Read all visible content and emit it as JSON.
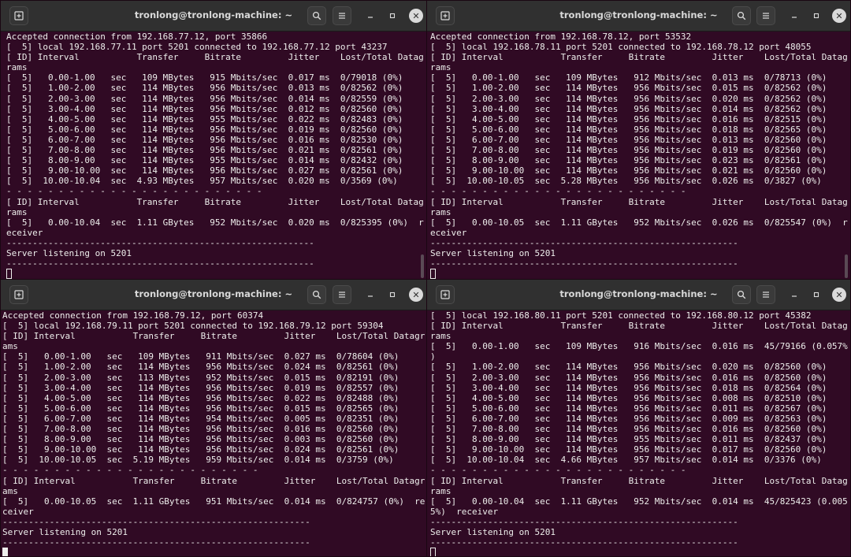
{
  "windows": [
    {
      "title": "tronlong@tronlong-machine: ~",
      "cursor_style": "hollow",
      "lines": [
        "Accepted connection from 192.168.77.12, port 35866",
        "[  5] local 192.168.77.11 port 5201 connected to 192.168.77.12 port 43237",
        "[ ID] Interval           Transfer     Bitrate         Jitter    Lost/Total Datag",
        "rams",
        "[  5]   0.00-1.00   sec   109 MBytes   915 Mbits/sec  0.017 ms  0/79018 (0%)",
        "[  5]   1.00-2.00   sec   114 MBytes   956 Mbits/sec  0.013 ms  0/82562 (0%)",
        "[  5]   2.00-3.00   sec   114 MBytes   956 Mbits/sec  0.014 ms  0/82559 (0%)",
        "[  5]   3.00-4.00   sec   114 MBytes   956 Mbits/sec  0.012 ms  0/82560 (0%)",
        "[  5]   4.00-5.00   sec   114 MBytes   955 Mbits/sec  0.022 ms  0/82483 (0%)",
        "[  5]   5.00-6.00   sec   114 MBytes   956 Mbits/sec  0.019 ms  0/82560 (0%)",
        "[  5]   6.00-7.00   sec   114 MBytes   956 Mbits/sec  0.016 ms  0/82530 (0%)",
        "[  5]   7.00-8.00   sec   114 MBytes   956 Mbits/sec  0.021 ms  0/82561 (0%)",
        "[  5]   8.00-9.00   sec   114 MBytes   955 Mbits/sec  0.014 ms  0/82432 (0%)",
        "[  5]   9.00-10.00  sec   114 MBytes   956 Mbits/sec  0.027 ms  0/82561 (0%)",
        "[  5]  10.00-10.04  sec  4.93 MBytes   957 Mbits/sec  0.020 ms  0/3569 (0%)",
        "- - - - - - - - - - - - - - - - - - - - - - - - -",
        "[ ID] Interval           Transfer     Bitrate         Jitter    Lost/Total Datag",
        "rams",
        "[  5]   0.00-10.04  sec  1.11 GBytes   952 Mbits/sec  0.020 ms  0/825395 (0%)  r",
        "eceiver",
        "-----------------------------------------------------------",
        "Server listening on 5201",
        "-----------------------------------------------------------",
        ""
      ]
    },
    {
      "title": "tronlong@tronlong-machine: ~",
      "cursor_style": "hollow",
      "lines": [
        "Accepted connection from 192.168.78.12, port 53532",
        "[  5] local 192.168.78.11 port 5201 connected to 192.168.78.12 port 48055",
        "[ ID] Interval           Transfer     Bitrate         Jitter    Lost/Total Datag",
        "rams",
        "[  5]   0.00-1.00   sec   109 MBytes   912 Mbits/sec  0.013 ms  0/78713 (0%)",
        "[  5]   1.00-2.00   sec   114 MBytes   956 Mbits/sec  0.015 ms  0/82562 (0%)",
        "[  5]   2.00-3.00   sec   114 MBytes   956 Mbits/sec  0.020 ms  0/82562 (0%)",
        "[  5]   3.00-4.00   sec   114 MBytes   956 Mbits/sec  0.014 ms  0/82562 (0%)",
        "[  5]   4.00-5.00   sec   114 MBytes   956 Mbits/sec  0.016 ms  0/82515 (0%)",
        "[  5]   5.00-6.00   sec   114 MBytes   956 Mbits/sec  0.018 ms  0/82565 (0%)",
        "[  5]   6.00-7.00   sec   114 MBytes   956 Mbits/sec  0.013 ms  0/82560 (0%)",
        "[  5]   7.00-8.00   sec   114 MBytes   956 Mbits/sec  0.019 ms  0/82560 (0%)",
        "[  5]   8.00-9.00   sec   114 MBytes   956 Mbits/sec  0.023 ms  0/82561 (0%)",
        "[  5]   9.00-10.00  sec   114 MBytes   956 Mbits/sec  0.021 ms  0/82560 (0%)",
        "[  5]  10.00-10.05  sec  5.28 MBytes   956 Mbits/sec  0.026 ms  0/3827 (0%)",
        "- - - - - - - - - - - - - - - - - - - - - - - - -",
        "[ ID] Interval           Transfer     Bitrate         Jitter    Lost/Total Datag",
        "rams",
        "[  5]   0.00-10.05  sec  1.11 GBytes   952 Mbits/sec  0.026 ms  0/825547 (0%)  r",
        "eceiver",
        "-----------------------------------------------------------",
        "Server listening on 5201",
        "-----------------------------------------------------------",
        ""
      ]
    },
    {
      "title": "tronlong@tronlong-machine: ~",
      "cursor_style": "solid",
      "lines": [
        "Accepted connection from 192.168.79.12, port 60374",
        "[  5] local 192.168.79.11 port 5201 connected to 192.168.79.12 port 59304",
        "[ ID] Interval           Transfer     Bitrate         Jitter    Lost/Total Datagr",
        "ams",
        "[  5]   0.00-1.00   sec   109 MBytes   911 Mbits/sec  0.027 ms  0/78604 (0%)",
        "[  5]   1.00-2.00   sec   114 MBytes   956 Mbits/sec  0.024 ms  0/82561 (0%)",
        "[  5]   2.00-3.00   sec   113 MBytes   952 Mbits/sec  0.015 ms  0/82191 (0%)",
        "[  5]   3.00-4.00   sec   114 MBytes   956 Mbits/sec  0.019 ms  0/82557 (0%)",
        "[  5]   4.00-5.00   sec   114 MBytes   956 Mbits/sec  0.022 ms  0/82488 (0%)",
        "[  5]   5.00-6.00   sec   114 MBytes   956 Mbits/sec  0.015 ms  0/82565 (0%)",
        "[  5]   6.00-7.00   sec   114 MBytes   954 Mbits/sec  0.005 ms  0/82351 (0%)",
        "[  5]   7.00-8.00   sec   114 MBytes   956 Mbits/sec  0.016 ms  0/82560 (0%)",
        "[  5]   8.00-9.00   sec   114 MBytes   956 Mbits/sec  0.003 ms  0/82560 (0%)",
        "[  5]   9.00-10.00  sec   114 MBytes   956 Mbits/sec  0.024 ms  0/82561 (0%)",
        "[  5]  10.00-10.05  sec  5.19 MBytes   959 Mbits/sec  0.014 ms  0/3759 (0%)",
        "- - - - - - - - - - - - - - - - - - - - - - - - -",
        "[ ID] Interval           Transfer     Bitrate         Jitter    Lost/Total Datagr",
        "ams",
        "[  5]   0.00-10.05  sec  1.11 GBytes   951 Mbits/sec  0.014 ms  0/824757 (0%)  re",
        "ceiver",
        "-----------------------------------------------------------",
        "Server listening on 5201",
        "-----------------------------------------------------------",
        ""
      ]
    },
    {
      "title": "tronlong@tronlong-machine: ~",
      "cursor_style": "hollow",
      "lines": [
        "[  5] local 192.168.80.11 port 5201 connected to 192.168.80.12 port 45382",
        "[ ID] Interval           Transfer     Bitrate         Jitter    Lost/Total Datag",
        "rams",
        "[  5]   0.00-1.00   sec   109 MBytes   916 Mbits/sec  0.016 ms  45/79166 (0.057%",
        ")",
        "[  5]   1.00-2.00   sec   114 MBytes   956 Mbits/sec  0.020 ms  0/82560 (0%)",
        "[  5]   2.00-3.00   sec   114 MBytes   956 Mbits/sec  0.016 ms  0/82560 (0%)",
        "[  5]   3.00-4.00   sec   114 MBytes   956 Mbits/sec  0.018 ms  0/82564 (0%)",
        "[  5]   4.00-5.00   sec   114 MBytes   956 Mbits/sec  0.008 ms  0/82510 (0%)",
        "[  5]   5.00-6.00   sec   114 MBytes   956 Mbits/sec  0.011 ms  0/82567 (0%)",
        "[  5]   6.00-7.00   sec   114 MBytes   956 Mbits/sec  0.009 ms  0/82563 (0%)",
        "[  5]   7.00-8.00   sec   114 MBytes   956 Mbits/sec  0.016 ms  0/82560 (0%)",
        "[  5]   8.00-9.00   sec   114 MBytes   955 Mbits/sec  0.011 ms  0/82437 (0%)",
        "[  5]   9.00-10.00  sec   114 MBytes   956 Mbits/sec  0.017 ms  0/82560 (0%)",
        "[  5]  10.00-10.04  sec  4.66 MBytes   957 Mbits/sec  0.014 ms  0/3376 (0%)",
        "- - - - - - - - - - - - - - - - - - - - - - - - -",
        "[ ID] Interval           Transfer     Bitrate         Jitter    Lost/Total Datag",
        "rams",
        "[  5]   0.00-10.04  sec  1.11 GBytes   952 Mbits/sec  0.014 ms  45/825423 (0.005",
        "5%)  receiver",
        "-----------------------------------------------------------",
        "Server listening on 5201",
        "-----------------------------------------------------------",
        ""
      ]
    }
  ],
  "icons": {
    "new_tab": "new-tab-icon",
    "search": "search-icon",
    "menu": "hamburger-menu-icon",
    "minimize": "minimize-icon",
    "maximize": "maximize-icon",
    "close": "close-icon"
  },
  "colors": {
    "terminal_bg": "#300a24",
    "terminal_fg": "#eeeeec",
    "titlebar_bg": "#303030"
  }
}
